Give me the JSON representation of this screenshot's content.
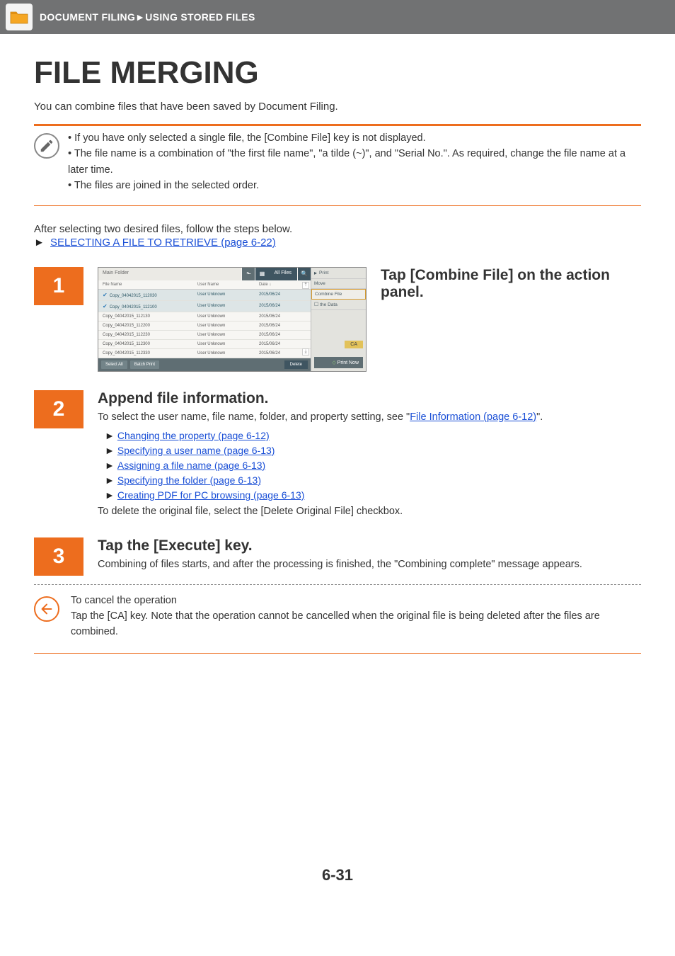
{
  "header": {
    "breadcrumb": "DOCUMENT FILING►USING STORED FILES"
  },
  "page_title": "FILE MERGING",
  "intro": "You can combine files that have been saved by Document Filing.",
  "notes": [
    "If you have only selected a single file, the [Combine File] key is not displayed.",
    "The file name is a combination of \"the first file name\", \"a tilde (~)\", and \"Serial No.\". As required, change the file name at a later time.",
    "The files are joined in the selected order."
  ],
  "after_select_text": "After selecting two desired files, follow the steps below.",
  "after_select_link": "SELECTING A FILE TO RETRIEVE (page 6-22)",
  "step1": {
    "num": "1",
    "title": "Tap [Combine File] on the action panel.",
    "shot": {
      "main_folder": "Main Folder",
      "all_files": "All Files",
      "cols": {
        "file": "File Name",
        "user": "User Name",
        "date": "Date"
      },
      "rows": [
        {
          "sel": true,
          "file": "Copy_04042015_112030",
          "user": "User Unknown",
          "date": "2015/06/24"
        },
        {
          "sel": true,
          "file": "Copy_04042015_112100",
          "user": "User Unknown",
          "date": "2015/06/24"
        },
        {
          "sel": false,
          "file": "Copy_04042015_112130",
          "user": "User Unknown",
          "date": "2015/06/24"
        },
        {
          "sel": false,
          "file": "Copy_04042015_112200",
          "user": "User Unknown",
          "date": "2015/06/24"
        },
        {
          "sel": false,
          "file": "Copy_04042015_112230",
          "user": "User Unknown",
          "date": "2015/06/24"
        },
        {
          "sel": false,
          "file": "Copy_04042015_112300",
          "user": "User Unknown",
          "date": "2015/06/24"
        },
        {
          "sel": false,
          "file": "Copy_04042015_112330",
          "user": "User Unknown",
          "date": "2015/06/24"
        }
      ],
      "footer": {
        "select_all": "Select All",
        "batch": "Batch Print",
        "delete": "Delete"
      },
      "action": {
        "print": "Print",
        "move": "Move",
        "combine": "Combine File",
        "thedata": "the Data",
        "ca": "CA",
        "print_now": "Print Now"
      }
    }
  },
  "step2": {
    "num": "2",
    "title": "Append file information.",
    "text_prefix": "To select the user name, file name, folder, and property setting, see \"",
    "text_link": "File Information (page 6-12)",
    "text_suffix": "\".",
    "links": [
      "Changing the property (page 6-12)",
      "Specifying a user name (page 6-13)",
      "Assigning a file name (page 6-13)",
      "Specifying the folder (page 6-13)",
      "Creating PDF for PC browsing (page 6-13)"
    ],
    "delete_text": "To delete the original file, select the [Delete Original File] checkbox."
  },
  "step3": {
    "num": "3",
    "title": "Tap the [Execute] key.",
    "text": "Combining of files starts, and after the processing is finished, the \"Combining complete\" message appears."
  },
  "cancel": {
    "title": "To cancel the operation",
    "text": "Tap the [CA] key. Note that the operation cannot be cancelled when the original file is being deleted after the files are combined."
  },
  "page_number": "6-31"
}
